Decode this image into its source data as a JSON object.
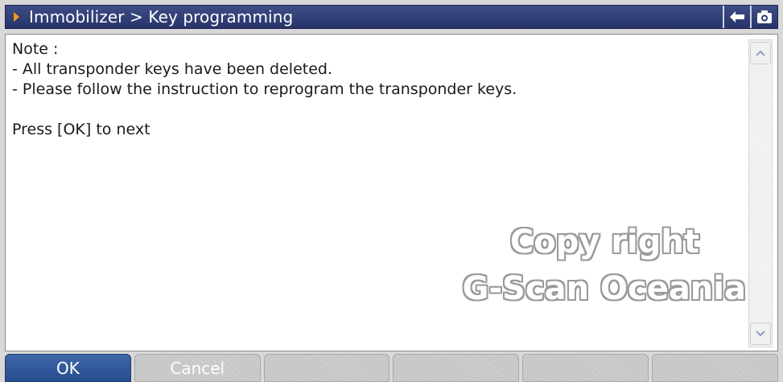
{
  "title_bar": {
    "breadcrumb": "Immobilizer > Key programming",
    "back_icon": "arrow-left-icon",
    "camera_icon": "camera-icon"
  },
  "message": {
    "lines": [
      "Note :",
      "- All transponder keys have been deleted.",
      "- Please follow the instruction to reprogram the transponder keys.",
      "",
      "Press [OK] to next"
    ]
  },
  "watermark": {
    "line1": "Copy right",
    "line2": "G-Scan Oceania"
  },
  "buttons": {
    "ok": "OK",
    "cancel": "Cancel",
    "empty": [
      "",
      "",
      "",
      ""
    ]
  },
  "colors": {
    "title_bg": "#2f3c75",
    "accent_arrow": "#f59a1e",
    "ok_button": "#2f5a9e",
    "disabled_button": "#c6c6c6"
  }
}
